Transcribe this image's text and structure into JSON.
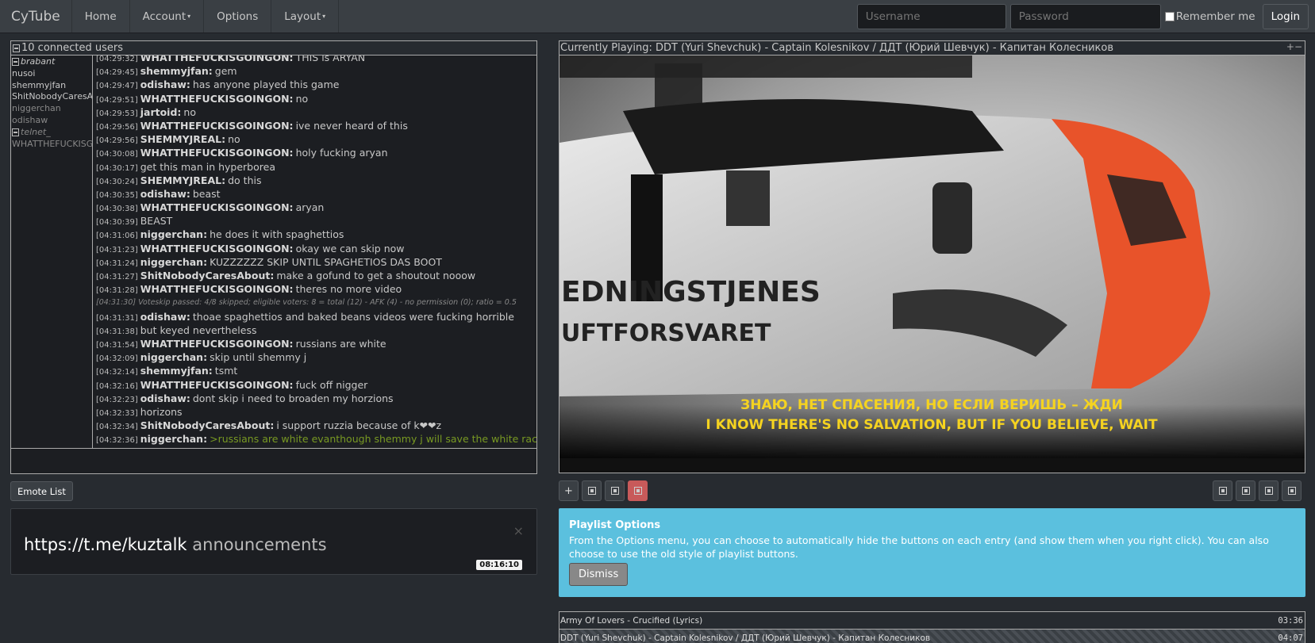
{
  "navbar": {
    "brand": "CyTube",
    "items": [
      {
        "label": "Home",
        "caret": ""
      },
      {
        "label": "Account",
        "caret": "▾"
      },
      {
        "label": "Options",
        "caret": ""
      },
      {
        "label": "Layout",
        "caret": "▾"
      }
    ],
    "username_placeholder": "Username",
    "password_placeholder": "Password",
    "remember_label": "Remember me",
    "login_label": "Login"
  },
  "chat": {
    "user_count": "10 connected users",
    "users": [
      {
        "name": "brabant",
        "afk": false,
        "italic": true,
        "icon": true
      },
      {
        "name": "nusoi",
        "afk": false,
        "italic": false,
        "icon": false
      },
      {
        "name": "shemmyjfan",
        "afk": false,
        "italic": false,
        "icon": false
      },
      {
        "name": "ShitNobodyCaresAbout",
        "afk": false,
        "italic": false,
        "icon": false
      },
      {
        "name": "niggerchan",
        "afk": true,
        "italic": false,
        "icon": false
      },
      {
        "name": "odishaw",
        "afk": true,
        "italic": false,
        "icon": false
      },
      {
        "name": "telnet_",
        "afk": true,
        "italic": true,
        "icon": true
      },
      {
        "name": "WHATTHEFUCKISGOINGON",
        "afk": true,
        "italic": false,
        "icon": false
      }
    ],
    "messages": [
      {
        "ts": "[04:29:32]",
        "nick": "WHATTHEFUCKISGOINGON:",
        "text": "THIS is ARYAN",
        "type": "normal"
      },
      {
        "ts": "[04:29:45]",
        "nick": "shemmyjfan:",
        "text": "gem",
        "type": "normal"
      },
      {
        "ts": "[04:29:47]",
        "nick": "odishaw:",
        "text": "has anyone played this game",
        "type": "normal"
      },
      {
        "ts": "[04:29:51]",
        "nick": "WHATTHEFUCKISGOINGON:",
        "text": "no",
        "type": "normal"
      },
      {
        "ts": "[04:29:53]",
        "nick": "jartoid:",
        "text": "no",
        "type": "normal"
      },
      {
        "ts": "[04:29:56]",
        "nick": "WHATTHEFUCKISGOINGON:",
        "text": "ive never heard of this",
        "type": "normal"
      },
      {
        "ts": "[04:29:56]",
        "nick": "SHEMMYJREAL:",
        "text": "no",
        "type": "normal"
      },
      {
        "ts": "[04:30:08]",
        "nick": "WHATTHEFUCKISGOINGON:",
        "text": "holy fucking aryan",
        "type": "normal"
      },
      {
        "ts": "[04:30:17]",
        "nick": "",
        "text": "get this man in hyperborea",
        "type": "normal"
      },
      {
        "ts": "[04:30:24]",
        "nick": "SHEMMYJREAL:",
        "text": "do this",
        "type": "normal"
      },
      {
        "ts": "[04:30:35]",
        "nick": "odishaw:",
        "text": "beast",
        "type": "normal"
      },
      {
        "ts": "[04:30:38]",
        "nick": "WHATTHEFUCKISGOINGON:",
        "text": "aryan",
        "type": "normal"
      },
      {
        "ts": "[04:30:39]",
        "nick": "",
        "text": "BEAST",
        "type": "normal"
      },
      {
        "ts": "[04:31:06]",
        "nick": "niggerchan:",
        "text": "he does it with spaghettios",
        "type": "normal"
      },
      {
        "ts": "[04:31:23]",
        "nick": "WHATTHEFUCKISGOINGON:",
        "text": "okay we can skip now",
        "type": "normal"
      },
      {
        "ts": "[04:31:24]",
        "nick": "niggerchan:",
        "text": "KUZZZZZZ SKIP UNTIL SPAGHETIOS DAS BOOT",
        "type": "normal"
      },
      {
        "ts": "[04:31:27]",
        "nick": "ShitNobodyCaresAbout:",
        "text": "make a gofund to get a shoutout nooow",
        "type": "normal"
      },
      {
        "ts": "[04:31:28]",
        "nick": "WHATTHEFUCKISGOINGON:",
        "text": "theres no more video",
        "type": "normal"
      },
      {
        "ts": "[04:31:30]",
        "nick": "",
        "text": "Voteskip passed: 4/8 skipped; eligible voters: 8 = total (12) - AFK (4) - no permission (0); ratio = 0.5",
        "type": "server"
      },
      {
        "ts": "[04:31:31]",
        "nick": "odishaw:",
        "text": "thoae spaghettios and baked beans videos were fucking horrible",
        "type": "normal"
      },
      {
        "ts": "[04:31:38]",
        "nick": "",
        "text": "but keyed nevertheless",
        "type": "normal"
      },
      {
        "ts": "[04:31:54]",
        "nick": "WHATTHEFUCKISGOINGON:",
        "text": "russians are white",
        "type": "normal"
      },
      {
        "ts": "[04:32:09]",
        "nick": "niggerchan:",
        "text": "skip until shemmy j",
        "type": "normal"
      },
      {
        "ts": "[04:32:14]",
        "nick": "shemmyjfan:",
        "text": "tsmt",
        "type": "normal"
      },
      {
        "ts": "[04:32:16]",
        "nick": "WHATTHEFUCKISGOINGON:",
        "text": "fuck off nigger",
        "type": "normal"
      },
      {
        "ts": "[04:32:23]",
        "nick": "odishaw:",
        "text": "dont skip i need to broaden my horzions",
        "type": "normal"
      },
      {
        "ts": "[04:32:33]",
        "nick": "",
        "text": "horizons",
        "type": "normal"
      },
      {
        "ts": "[04:32:34]",
        "nick": "ShitNobodyCaresAbout:",
        "text": "i support ruzzia because of k❤❤z",
        "type": "normal"
      },
      {
        "ts": "[04:32:36]",
        "nick": "niggerchan:",
        "text": ">russians are white evanthough shemmy j will save the white race",
        "type": "greentext"
      }
    ],
    "emote_list_label": "Emote List"
  },
  "announcement": {
    "link": "https://t.me/kuztalk",
    "suffix": " announcements",
    "close": "×",
    "clock": "08:16:10"
  },
  "video": {
    "title": "Currently Playing: DDT (Yuri Shevchuk) - Captain Kolesnikov / ДДТ (Юрий Шевчук) - Капитан Колесников",
    "header_controls": "+−",
    "aircraft_text_1": "EDNINGSTJENES",
    "aircraft_text_2": "UFTFORSVARET",
    "subtitle_ru": "ЗНАЮ, НЕТ СПАСЕНИЯ, НО ЕСЛИ ВЕРИШЬ – ЖДИ",
    "subtitle_en": "I KNOW THERE'S NO SALVATION, BUT IF YOU BELIEVE, WAIT"
  },
  "controls": {
    "add_label": "+"
  },
  "playlist_options": {
    "title": "Playlist Options",
    "body": "From the Options menu, you can choose to automatically hide the buttons on each entry (and show them when you right click). You can also choose to use the old style of playlist buttons.",
    "dismiss_label": "Dismiss"
  },
  "playlist": [
    {
      "title": "Army Of Lovers - Crucified (Lyrics)",
      "duration": "03:36",
      "active": false
    },
    {
      "title": "DDT (Yuri Shevchuk) - Captain Kolesnikov / ДДТ (Юрий Шевчук) - Капитан Колесников",
      "duration": "04:07",
      "active": true
    }
  ],
  "colors": {
    "background": "#272b30",
    "navbar": "#3a3f44",
    "alert": "#5bc0de",
    "greentext": "#789922",
    "subtitle": "#f5d320",
    "rescue_orange": "#e8532a"
  }
}
